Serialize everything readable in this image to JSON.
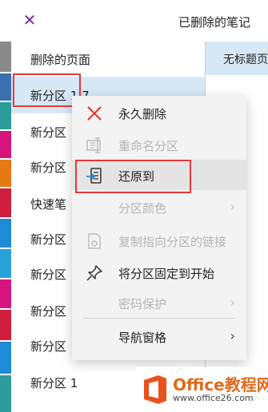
{
  "header": {
    "title": "已删除的笔记"
  },
  "tab_colors": [
    "#8a8a8a",
    "#3a6fb0",
    "#2a9c9c",
    "#d6137f",
    "#e57a14",
    "#d11e3c",
    "#1e8ad8",
    "#29a0d8",
    "#d6137f",
    "#d11e3c",
    "#1e8ad8",
    "#2a9c9c"
  ],
  "section_list": {
    "header": "删除的页面",
    "items": [
      {
        "label": "新分区 1 7"
      },
      {
        "label": "新分区"
      },
      {
        "label": "新分区"
      },
      {
        "label": "快速笔"
      },
      {
        "label": "新分区"
      },
      {
        "label": "新分区"
      },
      {
        "label": "新分区"
      },
      {
        "label": "新分区"
      },
      {
        "label": "新分区 1"
      }
    ]
  },
  "pages": {
    "item": "无标题页"
  },
  "context_menu": {
    "items": [
      {
        "label": "永久删除",
        "icon": "delete-x-icon",
        "enabled": true
      },
      {
        "label": "重命名分区",
        "icon": "rename-icon",
        "enabled": false
      },
      {
        "label": "还原到",
        "icon": "restore-icon",
        "enabled": true
      },
      {
        "label": "分区颜色",
        "icon": "",
        "enabled": false
      },
      {
        "label": "复制指向分区的链接",
        "icon": "copy-link-icon",
        "enabled": false
      },
      {
        "label": "将分区固定到开始",
        "icon": "pin-icon",
        "enabled": true
      },
      {
        "label": "密码保护",
        "icon": "",
        "enabled": false
      },
      {
        "label": "导航窗格",
        "icon": "",
        "enabled": true
      }
    ]
  },
  "watermark": {
    "name": "Office教程网",
    "url": "www.office26.com"
  }
}
